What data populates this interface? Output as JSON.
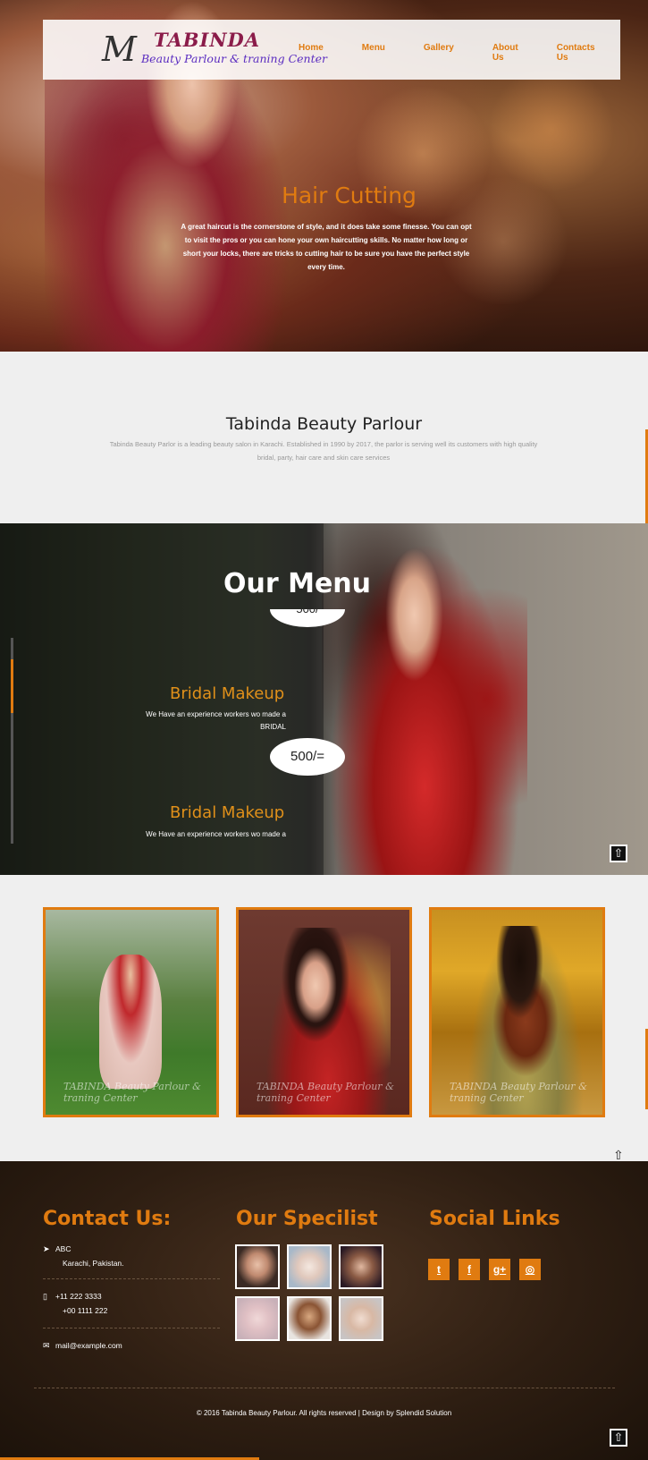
{
  "brand": {
    "logo_mark": "M",
    "name": "TABINDA",
    "tagline": "Beauty Parlour & traning Center"
  },
  "nav": {
    "items": [
      "Home",
      "Menu",
      "Gallery",
      "About Us",
      "Contacts Us"
    ]
  },
  "hero": {
    "title": "Hair Cutting",
    "text": "A great haircut is the cornerstone of style, and it does take some finesse. You can opt to visit the pros or you can hone your own haircutting skills. No matter how long or short your locks, there are tricks to cutting hair to be sure you have the perfect style every time."
  },
  "about": {
    "title": "Tabinda Beauty Parlour",
    "text": "Tabinda Beauty Parlor is a leading beauty salon in Karachi. Established in 1990 by 2017, the parlor is serving well its customers with high quality bridal, party, hair care and skin care services"
  },
  "menu": {
    "title": "Our Menu",
    "partial_price": "500/",
    "items": [
      {
        "title": "Bridal Makeup",
        "desc_line1": "We Have an experience workers wo made a",
        "desc_line2": "BRIDAL",
        "price": "500/="
      },
      {
        "title": "Bridal Makeup",
        "desc_line1": "We Have an experience workers wo made a"
      }
    ],
    "up_icon": "up-arrow-icon"
  },
  "gallery": {
    "watermarks": [
      "TABINDA Beauty Parlour & traning Center",
      "TABINDA Beauty Parlour & traning Center",
      "TABINDA Beauty Parlour & traning Center"
    ],
    "up_glyph": "⇧"
  },
  "footer": {
    "contact_title": "Contact Us:",
    "address_line1": "ABC",
    "address_line2": "Karachi, Pakistan.",
    "phone1": "+11 222 3333",
    "phone2": "+00 1111 222",
    "email": "mail@example.com",
    "specialist_title": "Our Specilist",
    "social_title": "Social Links",
    "social": [
      {
        "name": "twitter",
        "glyph": "t"
      },
      {
        "name": "facebook",
        "glyph": "f"
      },
      {
        "name": "google-plus",
        "glyph": "g+"
      },
      {
        "name": "dribbble",
        "glyph": "◎"
      }
    ],
    "copyright": "© 2016 Tabinda Beauty Parlour. All rights reserved | Design by Splendid Solution"
  },
  "colors": {
    "accent": "#e07b10",
    "brand_name": "#8b1c4a",
    "tagline": "#5a2cc0"
  }
}
